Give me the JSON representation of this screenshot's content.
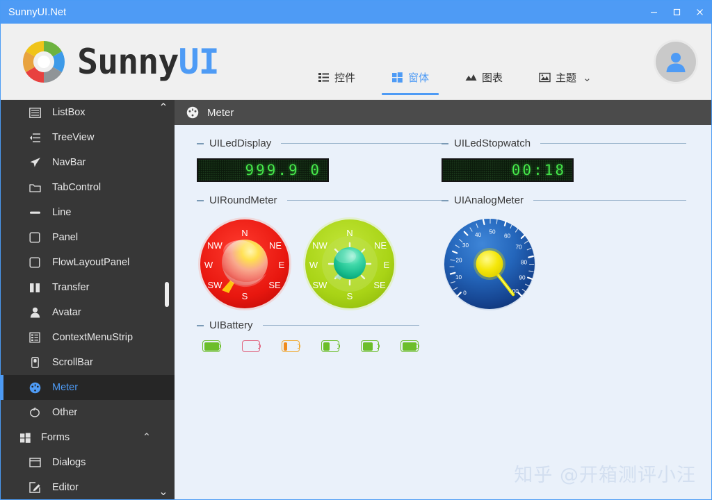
{
  "window": {
    "title": "SunnyUI.Net",
    "title_bg": "#4e9bf5",
    "controls": [
      {
        "name": "minimize",
        "glyph": "─"
      },
      {
        "name": "maximize",
        "glyph": "☐"
      },
      {
        "name": "close",
        "glyph": "✕"
      }
    ]
  },
  "header": {
    "logo_sunny": "Sunny",
    "logo_ui": "UI",
    "accent": "#4e9bf5",
    "nav": [
      {
        "id": "controls",
        "label": "控件",
        "icon": "list-icon",
        "active": false
      },
      {
        "id": "forms",
        "label": "窗体",
        "icon": "windows-icon",
        "active": true
      },
      {
        "id": "charts",
        "label": "图表",
        "icon": "chart-icon",
        "active": false
      },
      {
        "id": "themes",
        "label": "主题",
        "icon": "image-icon",
        "active": false
      }
    ],
    "nav_chevron": "⌄",
    "avatar_name": "user-avatar"
  },
  "sidebar": {
    "bg": "#373737",
    "scroll_up": "⌃",
    "scroll_down": "⌄",
    "items": [
      {
        "label": "ListBox",
        "icon": "listbox-icon",
        "active": false,
        "group": false
      },
      {
        "label": "TreeView",
        "icon": "treeview-icon",
        "active": false,
        "group": false
      },
      {
        "label": "NavBar",
        "icon": "navbar-icon",
        "active": false,
        "group": false
      },
      {
        "label": "TabControl",
        "icon": "folder-icon",
        "active": false,
        "group": false
      },
      {
        "label": "Line",
        "icon": "line-icon",
        "active": false,
        "group": false
      },
      {
        "label": "Panel",
        "icon": "panel-icon",
        "active": false,
        "group": false
      },
      {
        "label": "FlowLayoutPanel",
        "icon": "panel-icon",
        "active": false,
        "group": false
      },
      {
        "label": "Transfer",
        "icon": "transfer-icon",
        "active": false,
        "group": false
      },
      {
        "label": "Avatar",
        "icon": "avatar-icon",
        "active": false,
        "group": false
      },
      {
        "label": "ContextMenuStrip",
        "icon": "contextmenu-icon",
        "active": false,
        "group": false
      },
      {
        "label": "ScrollBar",
        "icon": "scrollbar-icon",
        "active": false,
        "group": false
      },
      {
        "label": "Meter",
        "icon": "meter-icon",
        "active": true,
        "group": false
      },
      {
        "label": "Other",
        "icon": "other-icon",
        "active": false,
        "group": false
      },
      {
        "label": "Forms",
        "icon": "windows-icon",
        "active": false,
        "group": true,
        "chevron": "⌃"
      },
      {
        "label": "Dialogs",
        "icon": "dialog-icon",
        "active": false,
        "group": false
      },
      {
        "label": "Editor",
        "icon": "editor-icon",
        "active": false,
        "group": false
      }
    ]
  },
  "content": {
    "header_title": "Meter",
    "header_icon": "meter-icon",
    "bg": "#eaf1fa",
    "sections": {
      "led_display": {
        "title": "UILedDisplay",
        "value": "999.9 0"
      },
      "led_stopwatch": {
        "title": "UILedStopwatch",
        "value": "00:18"
      },
      "round_meter": {
        "title": "UIRoundMeter"
      },
      "analog_meter": {
        "title": "UIAnalogMeter"
      },
      "battery": {
        "title": "UIBattery"
      }
    },
    "round_meters": [
      {
        "name": "round-meter-red",
        "dial_color": "#e51d1d",
        "ball_color": "#f5d24a",
        "needle_color": "#ffc20e",
        "needle_dir": "SW",
        "labels": [
          "N",
          "NE",
          "E",
          "SE",
          "S",
          "SW",
          "W",
          "NW"
        ]
      },
      {
        "name": "round-meter-green",
        "dial_color": "#aed81b",
        "ball_color": "#1fc89a",
        "needle_color": "#9fe0c8",
        "needle_dir": "SW",
        "labels": [
          "N",
          "NE",
          "E",
          "SE",
          "S",
          "SW",
          "W",
          "NW"
        ]
      }
    ],
    "analog_meter": {
      "name": "analog-meter",
      "dial_color": "#1f5fb0",
      "hub_color": "#f2e80b",
      "needle_color": "#e9e000",
      "min": 0,
      "max": 100,
      "value": 95,
      "ticks": [
        "0",
        "10",
        "20",
        "30",
        "40",
        "50",
        "60",
        "70",
        "80",
        "90",
        "100"
      ]
    },
    "batteries": [
      {
        "name": "battery-full-green",
        "percent": 100,
        "color": "#6cbe2a",
        "fill": "#6cbe2a"
      },
      {
        "name": "battery-empty-red",
        "percent": 0,
        "color": "#e0627d",
        "fill": "#e0627d"
      },
      {
        "name": "battery-low-orange",
        "percent": 25,
        "color": "#f0a92e",
        "fill": "#f08c1e"
      },
      {
        "name": "battery-mid-green-a",
        "percent": 45,
        "color": "#6cbe2a",
        "fill": "#6cbe2a"
      },
      {
        "name": "battery-mid-green-b",
        "percent": 68,
        "color": "#6cbe2a",
        "fill": "#6cbe2a"
      },
      {
        "name": "battery-high-green",
        "percent": 95,
        "color": "#6cbe2a",
        "fill": "#6cbe2a"
      }
    ]
  },
  "watermark": {
    "text": "知乎 @开箱测评小汪"
  }
}
